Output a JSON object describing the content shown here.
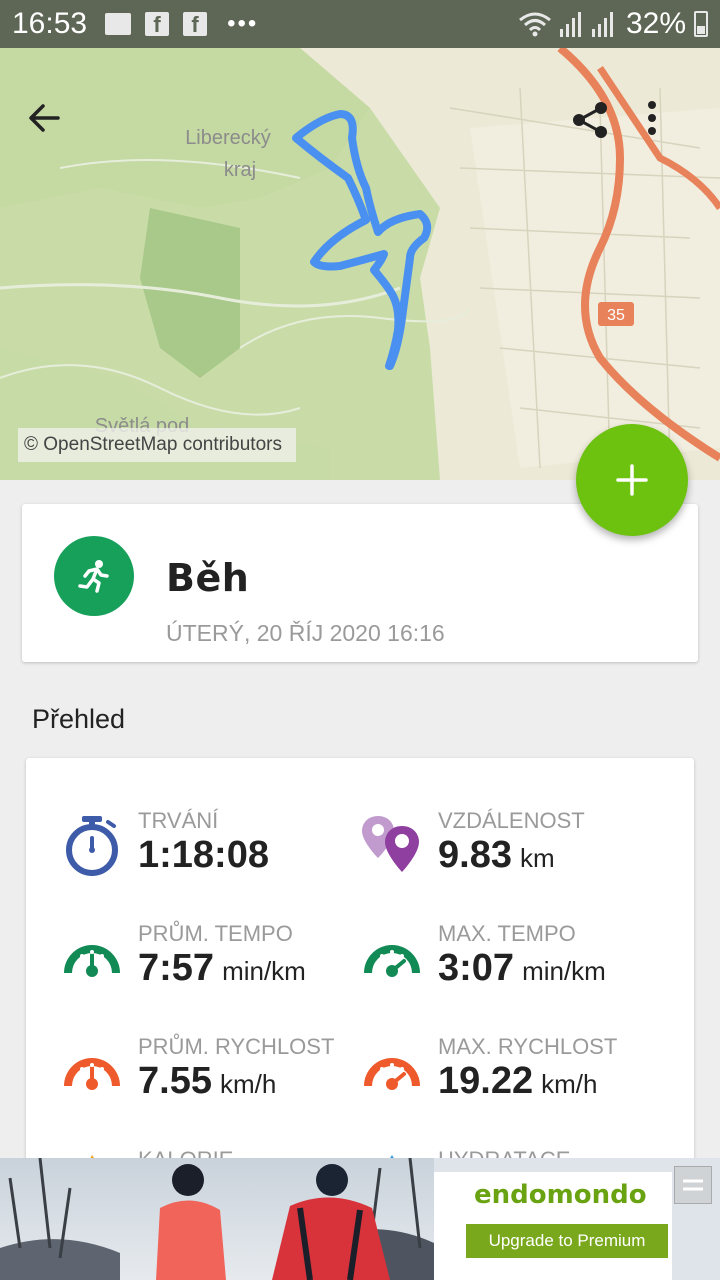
{
  "status_bar": {
    "time": "16:53",
    "battery": "32%",
    "icons": [
      "image-icon",
      "facebook-icon",
      "facebook-icon",
      "more-notifications-icon",
      "wifi-icon",
      "signal-icon",
      "signal-icon",
      "battery-icon"
    ]
  },
  "map": {
    "labels": {
      "region": "Liberecký kraj",
      "town": "Světlá pod Ještědem",
      "road_number": "35"
    },
    "attribution": "© OpenStreetMap contributors",
    "route_color": "#4a90f0",
    "road_color": "#e8825a",
    "back_icon": "arrow-back-icon",
    "share_icon": "share-icon",
    "menu_icon": "more-vert-icon"
  },
  "fab": {
    "icon": "plus-icon",
    "color": "#6cc20f"
  },
  "activity": {
    "title": "Běh",
    "date": "ÚTERÝ, 20 ŘÍJ 2020 16:16",
    "icon": "running-icon",
    "icon_color": "#16a05a"
  },
  "overview": {
    "title": "Přehled",
    "stats": {
      "duration": {
        "label": "TRVÁNÍ",
        "value": "1:18:08",
        "unit": "",
        "icon": "stopwatch-icon"
      },
      "distance": {
        "label": "VZDÁLENOST",
        "value": "9.83",
        "unit": "km",
        "icon": "location-pins-icon"
      },
      "avg_pace": {
        "label": "PRŮM. TEMPO",
        "value": "7:57",
        "unit": "min/km",
        "icon": "pace-gauge-icon"
      },
      "max_pace": {
        "label": "MAX. TEMPO",
        "value": "3:07",
        "unit": "min/km",
        "icon": "pace-gauge-icon"
      },
      "avg_speed": {
        "label": "PRŮM. RYCHLOST",
        "value": "7.55",
        "unit": "km/h",
        "icon": "speed-gauge-icon"
      },
      "max_speed": {
        "label": "MAX. RYCHLOST",
        "value": "19.22",
        "unit": "km/h",
        "icon": "speed-gauge-icon"
      },
      "calories": {
        "label": "KALORIE",
        "icon": "calories-icon"
      },
      "hydration": {
        "label": "HYDRATACE",
        "icon": "hydration-icon"
      }
    },
    "colors": {
      "blue": "#3d5ba8",
      "purple": "#8e3f9f",
      "green": "#128a55",
      "orange": "#ee5a2c"
    }
  },
  "ad": {
    "brand": "endomondo",
    "button": "Upgrade to Premium",
    "close_icon": "ad-close-icon"
  }
}
